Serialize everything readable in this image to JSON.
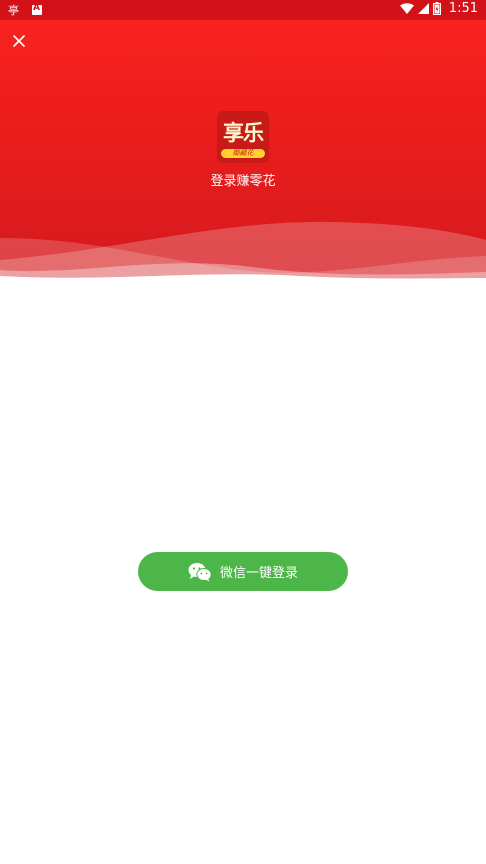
{
  "status_bar": {
    "time": "1:51",
    "icons": [
      "notification-app-icon",
      "notification-a-icon",
      "wifi-icon",
      "cell-signal-icon",
      "battery-icon"
    ]
  },
  "header": {
    "close_icon": "close-icon",
    "logo_text": "享乐",
    "logo_ribbon_text": "御藏花",
    "tagline": "登录赚零花",
    "colors": {
      "top": "#f8231f",
      "bottom": "#d31b1f"
    }
  },
  "login": {
    "wechat_icon": "wechat-icon",
    "wechat_button_label": "微信一键登录",
    "button_color": "#4cb748"
  }
}
